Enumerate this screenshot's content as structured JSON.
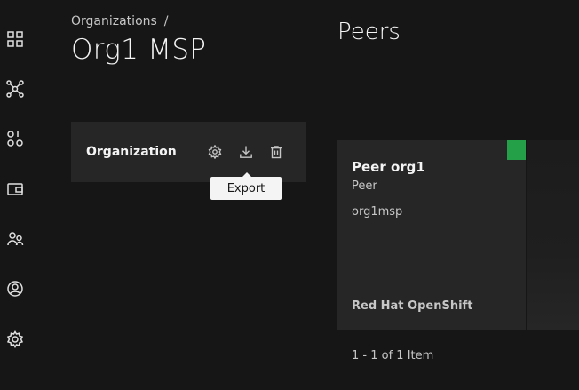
{
  "sidebar": {
    "items": [
      {
        "name": "dashboard",
        "icon": "dashboard-icon"
      },
      {
        "name": "nodes",
        "icon": "network-icon"
      },
      {
        "name": "channels",
        "icon": "channels-icon"
      },
      {
        "name": "wallet",
        "icon": "wallet-icon"
      },
      {
        "name": "users",
        "icon": "users-icon"
      },
      {
        "name": "profile",
        "icon": "user-avatar-icon"
      },
      {
        "name": "settings",
        "icon": "settings-icon"
      }
    ]
  },
  "header": {
    "breadcrumb": "Organizations",
    "breadcrumb_separator": "/",
    "title": "Org1 MSP"
  },
  "organization_tile": {
    "label": "Organization",
    "actions": [
      "settings-icon",
      "download-icon",
      "delete-icon"
    ],
    "tooltip": "Export"
  },
  "peers": {
    "title": "Peers",
    "items": [
      {
        "name": "Peer org1",
        "type": "Peer",
        "msp": "org1msp",
        "platform": "Red Hat OpenShift",
        "status_color": "#24a148"
      }
    ],
    "pagination": "1 - 1 of 1 Item"
  }
}
